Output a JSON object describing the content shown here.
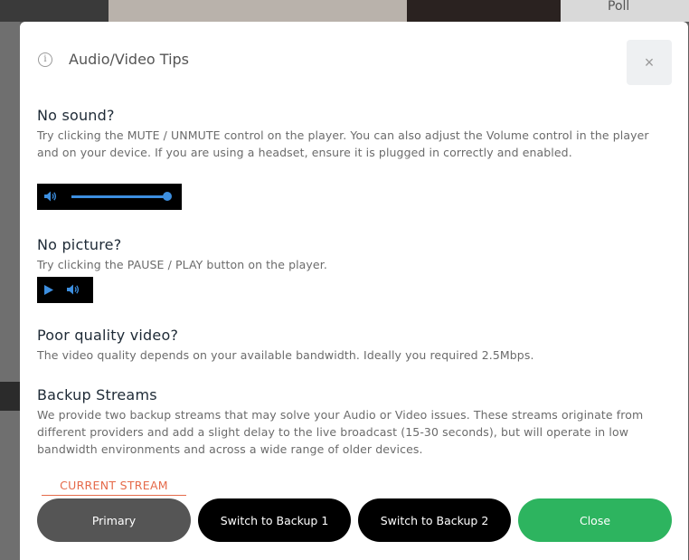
{
  "background": {
    "top_label": "Poll"
  },
  "modal": {
    "title": "Audio/Video Tips",
    "close_glyph": "×",
    "info_glyph": "i"
  },
  "sections": {
    "sound": {
      "heading": "No sound?",
      "body": "Try clicking the MUTE / UNMUTE control on the player. You can also adjust the Volume control in the player and on your device. If you are using a headset, ensure it is plugged in correctly and enabled.",
      "volume_level": 1.0
    },
    "picture": {
      "heading": "No picture?",
      "body": "Try clicking the PAUSE / PLAY button on the player."
    },
    "quality": {
      "heading": "Poor quality video?",
      "body": "The video quality depends on your available bandwidth. Ideally you required 2.5Mbps."
    },
    "backup": {
      "heading": "Backup Streams",
      "body": "We provide two backup streams that may solve your Audio or Video issues. These streams originate from different providers and add a slight delay to the live broadcast (15-30 seconds), but will operate in low bandwidth environments and across a wide range of older devices."
    }
  },
  "streams": {
    "current_label": "CURRENT STREAM",
    "primary": "Primary",
    "backup1": "Switch to Backup 1",
    "backup2": "Switch to Backup 2",
    "close": "Close"
  },
  "icons": {
    "info": "info-icon",
    "close": "close-icon",
    "speaker": "speaker-icon",
    "play": "play-icon"
  },
  "colors": {
    "accent_blue": "#3d8fe0",
    "current_stream": "#e56a4a",
    "close_green": "#2db45f",
    "primary_gray": "#555555",
    "backup_black": "#000000"
  }
}
